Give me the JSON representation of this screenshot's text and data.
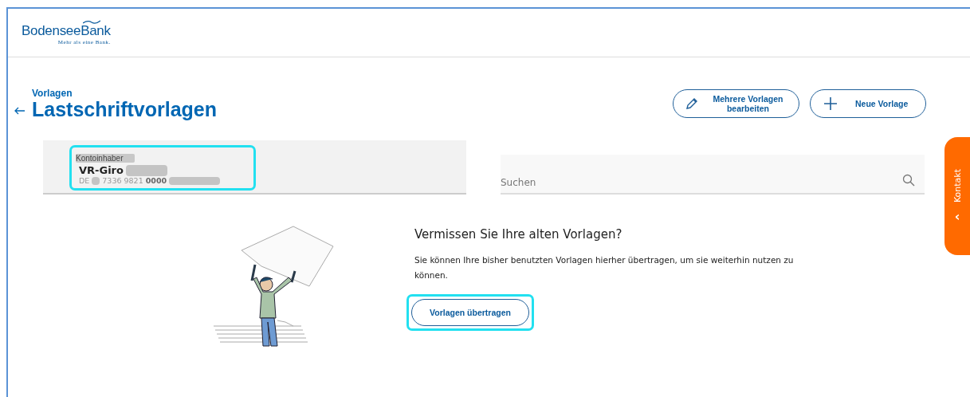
{
  "header": {
    "logo": "BodenseeBank",
    "slogan": "Mehr als eine Bank."
  },
  "page": {
    "breadcrumb": "Vorlagen",
    "title": "Lastschriftvorlagen"
  },
  "actions": [
    {
      "kind": "edit",
      "label": "Mehrere Vorlagen bearbeiten"
    },
    {
      "kind": "add",
      "label": "Neue Vorlage"
    }
  ],
  "account": {
    "owner_label": "Kontoinhaber",
    "name": "VR-Giro",
    "iban_prefix": "DE",
    "iban_middle": "7336 9821",
    "iban_bold": "0000",
    "highlighted": true
  },
  "search": {
    "placeholder": "Suchen"
  },
  "contact_tab": {
    "label": "Kontakt",
    "chevron": "‹"
  },
  "empty_state": {
    "heading": "Vermissen Sie Ihre alten Vorlagen?",
    "text": "Sie können Ihre bisher benutzten Vorlagen hierher übertragen, um sie weiterhin nutzen zu können.",
    "button": "Vorlagen übertragen",
    "button_highlighted": true
  }
}
